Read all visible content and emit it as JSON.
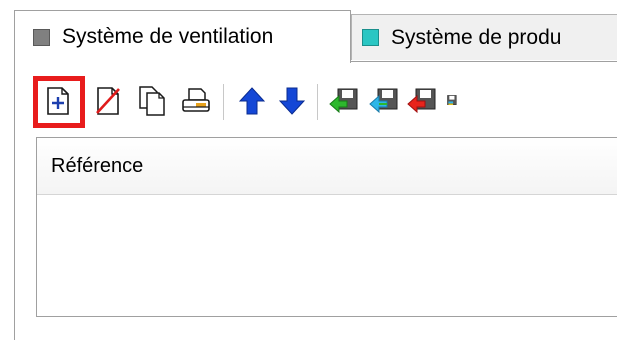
{
  "tabs": [
    {
      "label": "Système de ventilation",
      "swatch_color": "#808080",
      "active": true
    },
    {
      "label": "Système de produ",
      "swatch_color": "#2ac6c3",
      "active": false
    }
  ],
  "toolbar": {
    "buttons": [
      {
        "icon": "add-icon",
        "highlighted": true
      },
      {
        "icon": "delete-icon"
      },
      {
        "icon": "copy-icon"
      },
      {
        "icon": "print-icon"
      },
      {
        "icon": "arrow-up-icon"
      },
      {
        "icon": "arrow-down-icon"
      },
      {
        "icon": "save-green-icon"
      },
      {
        "icon": "save-blue-icon"
      },
      {
        "icon": "save-red-icon"
      },
      {
        "icon": "save-multi-icon"
      }
    ],
    "highlight_color": "#e81c1c"
  },
  "grid": {
    "columns": [
      "Référence"
    ],
    "rows": []
  }
}
